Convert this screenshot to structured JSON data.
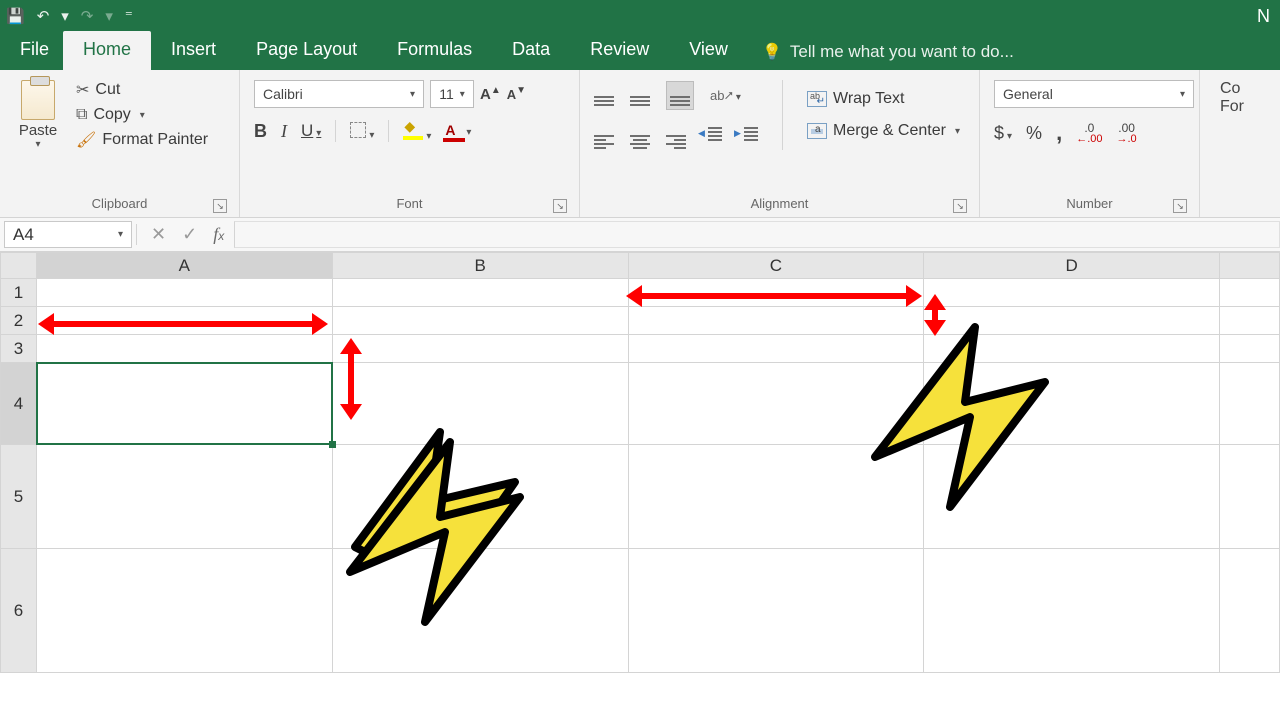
{
  "qat": {
    "save": "💾",
    "undo": "↶",
    "redo": "↷",
    "customize": "⁼"
  },
  "tabs": {
    "file": "File",
    "home": "Home",
    "insert": "Insert",
    "pagelayout": "Page Layout",
    "formulas": "Formulas",
    "data": "Data",
    "review": "Review",
    "view": "View",
    "tellme": "Tell me what you want to do..."
  },
  "ribbon": {
    "clipboard": {
      "paste": "Paste",
      "cut": "Cut",
      "copy": "Copy",
      "format_painter": "Format Painter",
      "group": "Clipboard"
    },
    "font": {
      "name": "Calibri",
      "size": "11",
      "bold": "B",
      "italic": "I",
      "underline": "U",
      "font_color_letter": "A",
      "group": "Font"
    },
    "align": {
      "wrap": "Wrap Text",
      "merge": "Merge & Center",
      "group": "Alignment"
    },
    "number": {
      "format": "General",
      "dollar": "$",
      "percent": "%",
      "comma": ",",
      "inc": ".0 .00",
      "dec": ".00 .0",
      "group": "Number"
    },
    "cond": {
      "label1": "Co",
      "label2": "For"
    }
  },
  "namebox": "A4",
  "columns": [
    "A",
    "B",
    "C",
    "D"
  ],
  "rows": [
    "1",
    "2",
    "3",
    "4",
    "5",
    "6"
  ],
  "selected_cell": "A4",
  "titlebar_right": "N"
}
